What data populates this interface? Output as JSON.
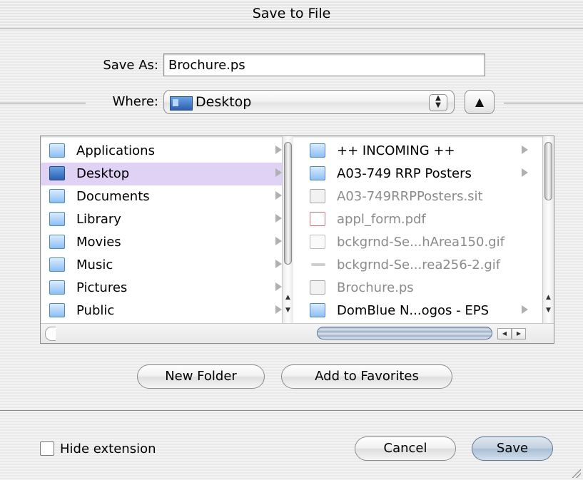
{
  "window": {
    "title": "Save to File"
  },
  "save_as": {
    "label": "Save As:",
    "value": "Brochure.ps"
  },
  "where": {
    "label": "Where:",
    "value": "Desktop"
  },
  "sidebar": {
    "items": [
      {
        "label": "Applications",
        "icon": "applications-folder-icon",
        "selected": false
      },
      {
        "label": "Desktop",
        "icon": "desktop-icon",
        "selected": true
      },
      {
        "label": "Documents",
        "icon": "documents-folder-icon",
        "selected": false
      },
      {
        "label": "Library",
        "icon": "library-folder-icon",
        "selected": false
      },
      {
        "label": "Movies",
        "icon": "movies-folder-icon",
        "selected": false
      },
      {
        "label": "Music",
        "icon": "music-folder-icon",
        "selected": false
      },
      {
        "label": "Pictures",
        "icon": "pictures-folder-icon",
        "selected": false
      },
      {
        "label": "Public",
        "icon": "public-folder-icon",
        "selected": false
      }
    ]
  },
  "files": {
    "items": [
      {
        "label": "++ INCOMING ++",
        "icon": "folder-icon",
        "disabled": false
      },
      {
        "label": "A03-749 RRP Posters",
        "icon": "folder-icon",
        "disabled": false
      },
      {
        "label": "A03-749RRPPosters.sit",
        "icon": "archive-file-icon",
        "disabled": true
      },
      {
        "label": "appl_form.pdf",
        "icon": "pdf-file-icon",
        "disabled": true
      },
      {
        "label": "bckgrnd-Se...hArea150.gif",
        "icon": "gif-file-icon",
        "disabled": true
      },
      {
        "label": "bckgrnd-Se...rea256-2.gif",
        "icon": "generic-file-icon",
        "disabled": true
      },
      {
        "label": "Brochure.ps",
        "icon": "ps-file-icon",
        "disabled": true
      },
      {
        "label": "DomBlue N...ogos - EPS",
        "icon": "folder-icon",
        "disabled": false
      }
    ]
  },
  "buttons": {
    "new_folder": "New Folder",
    "add_favorites": "Add to Favorites",
    "cancel": "Cancel",
    "save": "Save"
  },
  "hide_extension": {
    "label": "Hide extension",
    "checked": false
  }
}
